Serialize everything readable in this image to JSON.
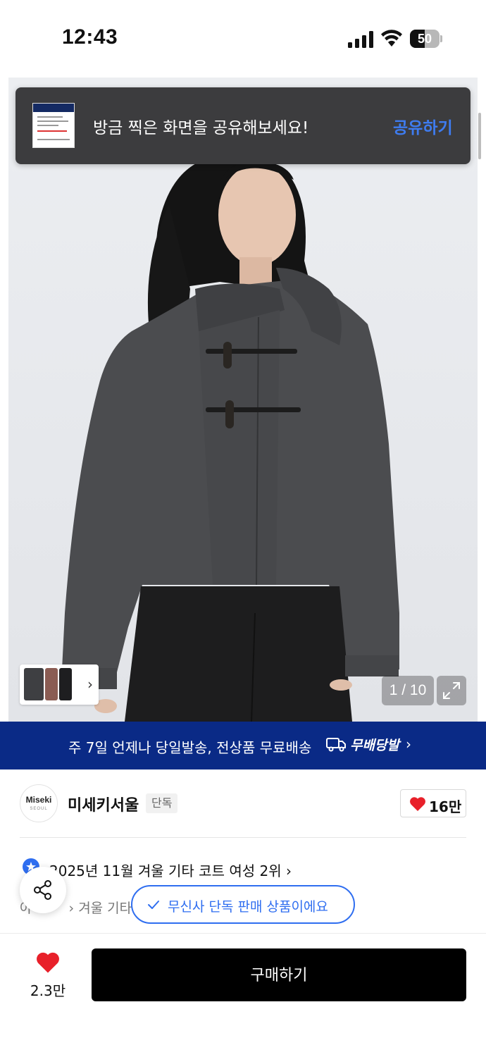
{
  "status_bar": {
    "time": "12:43",
    "battery_level": "50",
    "icons": [
      "signal-icon",
      "wifi-icon",
      "battery-icon"
    ]
  },
  "toast": {
    "message": "방금 찍은 화면을 공유해보세요!",
    "action": "공유하기",
    "action_color": "#3e7cf0"
  },
  "gallery": {
    "current": "1 / 10"
  },
  "delivery_banner": {
    "text": "주 7일 언제나 당일발송, 전상품 무료배송",
    "badge": "무배당발",
    "background": "#0a2a86"
  },
  "brand": {
    "logo_name": "Miseki",
    "logo_sub": "SEOUL",
    "name": "미세키서울",
    "tag": "단독",
    "likes": "16만"
  },
  "ranking": {
    "text": "2025년 11월 겨울 기타 코트 여성 2위"
  },
  "category": {
    "path_prefix": "아",
    "path_visible": "겨울 기타"
  },
  "exclusive_pill": {
    "text": "무신사 단독 판매 상품이에요",
    "color": "#2f6ef0"
  },
  "bottom_bar": {
    "likes": "2.3만",
    "buy_label": "구매하기",
    "heart_color": "#e8202a"
  }
}
